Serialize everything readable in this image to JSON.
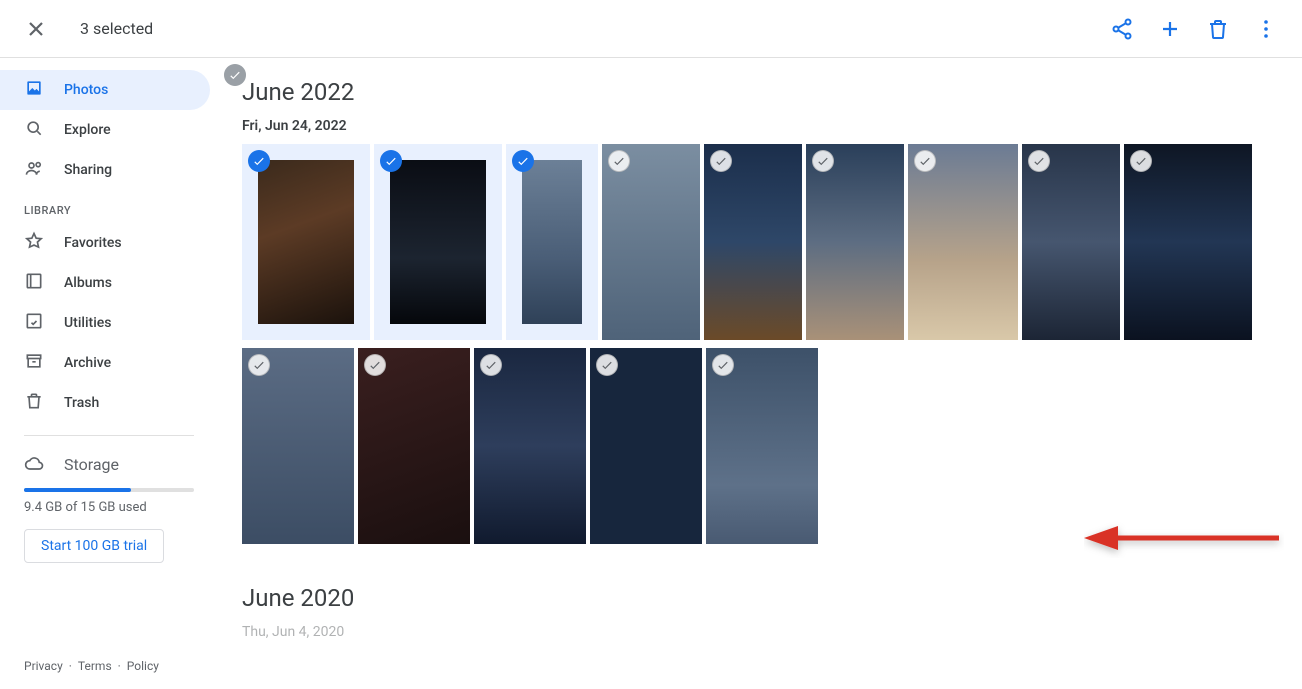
{
  "topbar": {
    "selection_label": "3 selected"
  },
  "sidebar": {
    "nav": [
      {
        "label": "Photos",
        "icon": "image-icon",
        "active": true
      },
      {
        "label": "Explore",
        "icon": "search-icon",
        "active": false
      },
      {
        "label": "Sharing",
        "icon": "people-icon",
        "active": false
      }
    ],
    "library_label": "LIBRARY",
    "library": [
      {
        "label": "Favorites",
        "icon": "star-icon"
      },
      {
        "label": "Albums",
        "icon": "album-icon"
      },
      {
        "label": "Utilities",
        "icon": "utilities-icon"
      },
      {
        "label": "Archive",
        "icon": "archive-icon"
      },
      {
        "label": "Trash",
        "icon": "trash-icon"
      }
    ],
    "storage": {
      "label": "Storage",
      "used_text": "9.4 GB of 15 GB used",
      "percent": 63,
      "trial_button": "Start 100 GB trial"
    },
    "footer": {
      "privacy": "Privacy",
      "terms": "Terms",
      "policy": "Policy"
    }
  },
  "main": {
    "groups": [
      {
        "title": "June 2022",
        "date_label": "Fri, Jun 24, 2022",
        "date_selected": true,
        "photos_row1": [
          {
            "selected": true,
            "w": 128,
            "g": "g1"
          },
          {
            "selected": true,
            "w": 128,
            "g": "g2"
          },
          {
            "selected": true,
            "w": 92,
            "g": "g3"
          },
          {
            "selected": false,
            "w": 98,
            "g": "g4"
          },
          {
            "selected": false,
            "w": 98,
            "g": "g5"
          },
          {
            "selected": false,
            "w": 98,
            "g": "g6"
          },
          {
            "selected": false,
            "w": 110,
            "g": "g7"
          },
          {
            "selected": false,
            "w": 98,
            "g": "g8"
          },
          {
            "selected": false,
            "w": 128,
            "g": "g9"
          }
        ],
        "photos_row2": [
          {
            "selected": false,
            "g": "r1"
          },
          {
            "selected": false,
            "g": "r2"
          },
          {
            "selected": false,
            "g": "r3"
          },
          {
            "selected": false,
            "g": "r4"
          },
          {
            "selected": false,
            "g": "r5"
          }
        ]
      },
      {
        "title": "June 2020",
        "date_label": "Thu, Jun 4, 2020",
        "date_selected": false
      }
    ]
  }
}
